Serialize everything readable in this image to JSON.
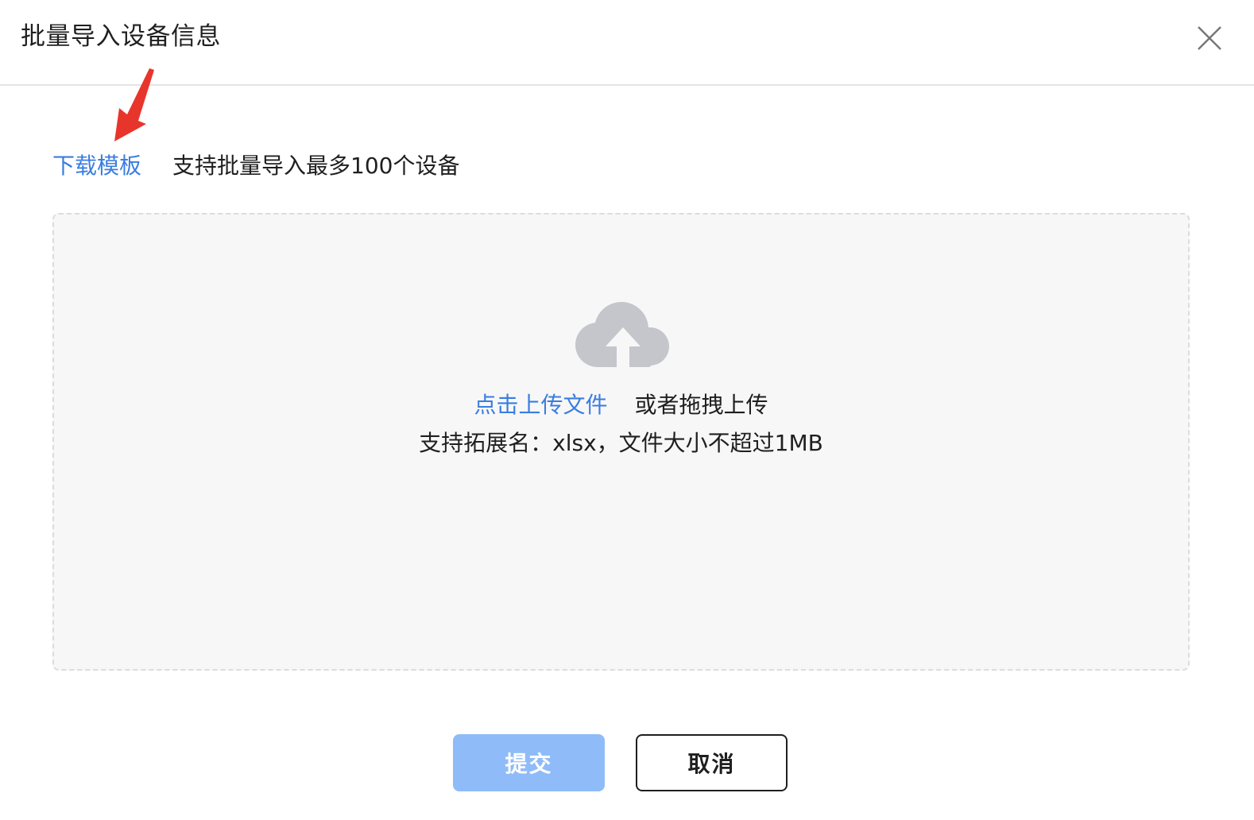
{
  "dialog": {
    "title": "批量导入设备信息",
    "close_icon": "close-icon"
  },
  "toolbar": {
    "download_label": "下载模板",
    "limit_text": "支持批量导入最多100个设备"
  },
  "annotation": {
    "arrow_icon": "red-arrow-pointer",
    "arrow_color": "#e8352b"
  },
  "dropzone": {
    "icon": "cloud-upload-icon",
    "upload_link": "点击上传文件",
    "drag_text": "或者拖拽上传",
    "hint": "支持拓展名：xlsx，文件大小不超过1MB"
  },
  "footer": {
    "submit_label": "提交",
    "cancel_label": "取消"
  },
  "colors": {
    "accent": "#3a7de0",
    "submit_disabled": "#8fbcf8",
    "dropzone_bg": "#f7f7f7",
    "icon_gray": "#c4c6cc"
  }
}
